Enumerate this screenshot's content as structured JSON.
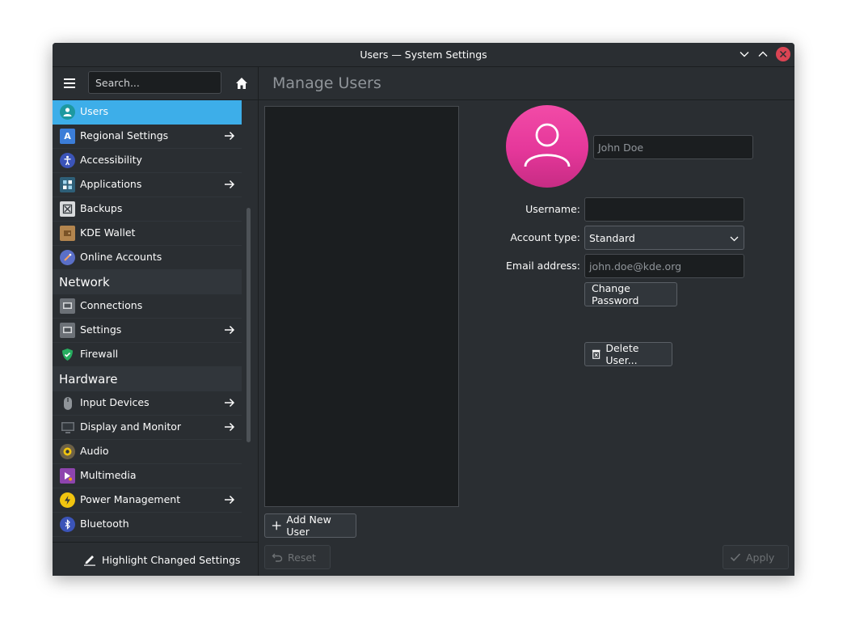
{
  "window": {
    "title": "Users — System Settings"
  },
  "sidebar": {
    "search_placeholder": "Search...",
    "items": [
      {
        "label": "Users",
        "icon": "users-icon",
        "arrow": false,
        "selected": true
      },
      {
        "label": "Regional Settings",
        "icon": "regional-icon",
        "arrow": true
      },
      {
        "label": "Accessibility",
        "icon": "accessibility-icon",
        "arrow": false
      },
      {
        "label": "Applications",
        "icon": "applications-icon",
        "arrow": true
      },
      {
        "label": "Backups",
        "icon": "backups-icon",
        "arrow": false
      },
      {
        "label": "KDE Wallet",
        "icon": "wallet-icon",
        "arrow": false
      },
      {
        "label": "Online Accounts",
        "icon": "online-accounts-icon",
        "arrow": false
      }
    ],
    "network_header": "Network",
    "network_items": [
      {
        "label": "Connections",
        "icon": "connections-icon",
        "arrow": false
      },
      {
        "label": "Settings",
        "icon": "network-settings-icon",
        "arrow": true
      },
      {
        "label": "Firewall",
        "icon": "firewall-icon",
        "arrow": false
      }
    ],
    "hardware_header": "Hardware",
    "hardware_items": [
      {
        "label": "Input Devices",
        "icon": "mouse-icon",
        "arrow": true
      },
      {
        "label": "Display and Monitor",
        "icon": "monitor-icon",
        "arrow": true
      },
      {
        "label": "Audio",
        "icon": "audio-icon",
        "arrow": false
      },
      {
        "label": "Multimedia",
        "icon": "multimedia-icon",
        "arrow": false
      },
      {
        "label": "Power Management",
        "icon": "power-icon",
        "arrow": true
      },
      {
        "label": "Bluetooth",
        "icon": "bluetooth-icon",
        "arrow": false
      }
    ],
    "footer_label": "Highlight Changed Settings"
  },
  "main": {
    "title": "Manage Users",
    "add_user_label": "Add New User",
    "reset_label": "Reset",
    "apply_label": "Apply",
    "user_form": {
      "fullname_placeholder": "John Doe",
      "username_label": "Username:",
      "username_value": "",
      "account_type_label": "Account type:",
      "account_type_value": "Standard",
      "email_label": "Email address:",
      "email_placeholder": "john.doe@kde.org",
      "change_password_label": "Change Password",
      "delete_user_label": "Delete User..."
    }
  },
  "colors": {
    "accent": "#3daee9",
    "window_bg": "#2a2e32",
    "avatar": "#e5379a",
    "close": "#da4453"
  }
}
